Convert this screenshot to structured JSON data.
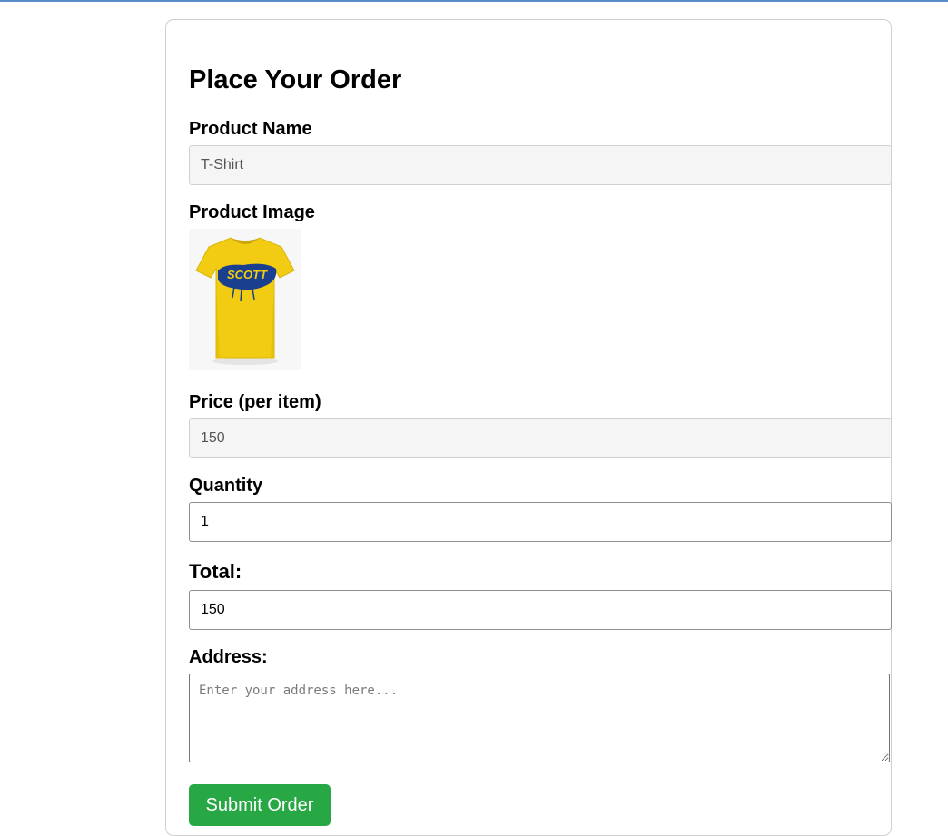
{
  "form": {
    "title": "Place Your Order",
    "product_name": {
      "label": "Product Name",
      "value": "T-Shirt"
    },
    "product_image": {
      "label": "Product Image",
      "alt": "T-Shirt",
      "logo_text": "SCOTT"
    },
    "price": {
      "label": "Price (per item)",
      "value": "150"
    },
    "quantity": {
      "label": "Quantity",
      "value": "1"
    },
    "total": {
      "label": "Total:",
      "value": "150"
    },
    "address": {
      "label": "Address:",
      "placeholder": "Enter your address here..."
    },
    "submit_label": "Submit Order"
  },
  "colors": {
    "submit_bg": "#28a745",
    "shirt": "#f2cc12",
    "logo": "#1a3f8f"
  }
}
